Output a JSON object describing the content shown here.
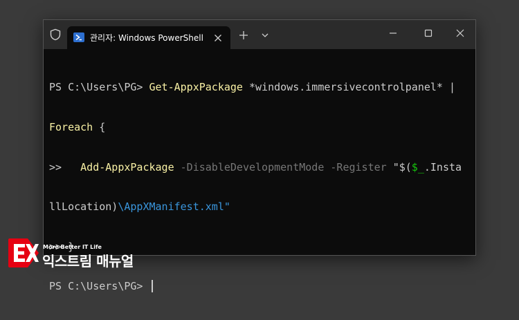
{
  "window": {
    "tab_title": "관리자: Windows PowerShell",
    "icons": [
      "shield-icon",
      "powershell-icon",
      "close-icon",
      "plus-icon",
      "chevron-down-icon",
      "minimize-icon",
      "maximize-icon",
      "close-icon"
    ]
  },
  "terminal": {
    "line1_prompt": "PS C:\\Users\\PG> ",
    "line1_cmd": "Get-AppxPackage",
    "line1_rest": " *windows.immersivecontrolpanel* |",
    "line2_cmd": "Foreach",
    "line2_rest": " {",
    "line3_prefix": ">>   ",
    "line3_cmd": "Add-AppxPackage",
    "line3_param": " -DisableDevelopmentMode -Register ",
    "line3_str1": "\"$(",
    "line3_var": "$_",
    "line3_str2": ".Insta",
    "line4_str1": "llLocation)",
    "line4_str2": "\\AppXManifest.xml\"",
    "line5": ">> }",
    "line6_prompt": "PS C:\\Users\\PG> "
  },
  "watermark": {
    "tagline": "More Better IT Life",
    "brand": "익스트림 매뉴얼",
    "colors": {
      "logo_red": "#e60012",
      "logo_white": "#ffffff"
    }
  },
  "colors": {
    "background": "#3a3a3a",
    "titlebar": "#2b2b2b",
    "terminal_bg": "#0c0c0c",
    "text": "#cccccc",
    "command": "#f9f1a5",
    "parameter": "#767676",
    "string": "#3a96dd",
    "variable": "#16c60c"
  }
}
